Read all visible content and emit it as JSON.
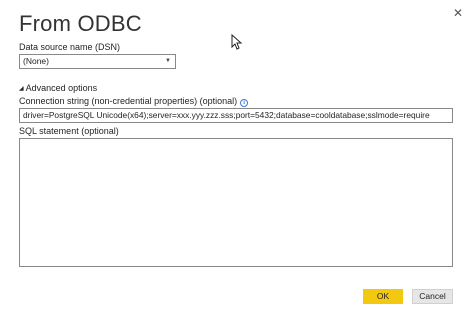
{
  "dialog": {
    "title": "From ODBC",
    "close_glyph": "✕"
  },
  "dsn": {
    "label": "Data source name (DSN)",
    "selected": "(None)"
  },
  "advanced": {
    "toggle_label": "Advanced options",
    "connection_label": "Connection string (non-credential properties) (optional)",
    "connection_value": "driver=PostgreSQL Unicode(x64);server=xxx.yyy.zzz.sss;port=5432;database=cooldatabase;sslmode=require",
    "sql_label": "SQL statement (optional)",
    "sql_value": ""
  },
  "buttons": {
    "ok_label": "OK",
    "cancel_label": "Cancel"
  },
  "colors": {
    "ok_background": "#f2c811",
    "cancel_background": "#e6e6e6",
    "info_icon": "#3a7bd5"
  },
  "icons": [
    "close-icon",
    "chevron-down-icon",
    "triangle-down-icon",
    "info-icon",
    "mouse-cursor-icon"
  ]
}
